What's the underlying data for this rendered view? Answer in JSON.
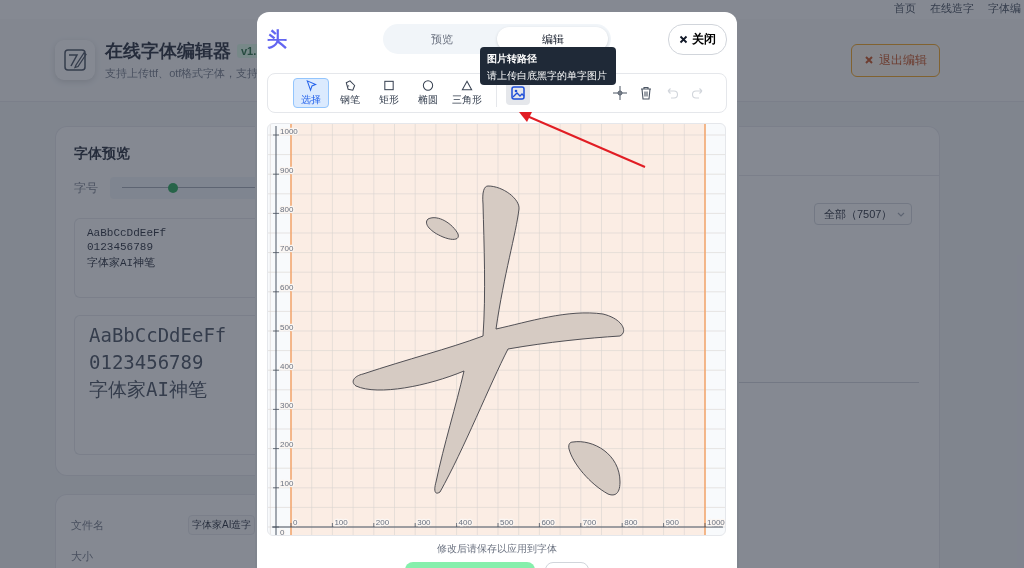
{
  "nav": [
    {
      "label": "首页"
    },
    {
      "label": "在线造字"
    },
    {
      "label": "字体编"
    }
  ],
  "header": {
    "title": "在线字体编辑器",
    "version": "v1.",
    "subtitle": "支持上传ttf、otf格式字体，支持",
    "exit_button": "退出编辑"
  },
  "preview_card": {
    "title": "字体预览",
    "size_label": "字号",
    "size_slider": {
      "level": 0.35
    },
    "sample_lines": [
      "AaBbCcDdEeFf",
      "0123456789",
      "字体家AI神笔"
    ],
    "rendered_lines": [
      "AaBbCcDdEeFf",
      "0123456789",
      "字体家AI神笔"
    ]
  },
  "info_card": {
    "rows": [
      {
        "label": "文件名",
        "value": "字体家AI造字"
      },
      {
        "label": "大小"
      }
    ]
  },
  "filter_select": {
    "value": "全部（7507）"
  },
  "editor": {
    "glyph": "头",
    "tabs": [
      {
        "label": "预览",
        "selected": false
      },
      {
        "label": "编辑",
        "selected": true
      }
    ],
    "close_button": "关闭",
    "tools": [
      {
        "kind": "pointer",
        "label": "选择",
        "selected": true
      },
      {
        "kind": "pen",
        "label": "钢笔",
        "selected": false
      },
      {
        "kind": "rect",
        "label": "矩形",
        "selected": false
      },
      {
        "kind": "ellipse",
        "label": "椭圆",
        "selected": false
      },
      {
        "kind": "triangle",
        "label": "三角形",
        "selected": false
      }
    ],
    "actions": [
      {
        "kind": "crosshair",
        "disabled": false
      },
      {
        "kind": "trash",
        "disabled": false
      },
      {
        "kind": "undo",
        "disabled": true
      },
      {
        "kind": "redo",
        "disabled": true
      }
    ],
    "tooltip": {
      "title": "图片转路径",
      "text": "请上传白底黑字的单字图片"
    },
    "x_ticks": [
      "0",
      "100",
      "200",
      "300",
      "400",
      "500",
      "600",
      "700",
      "800",
      "900",
      "1000"
    ],
    "y_ticks": [
      "1000",
      "900",
      "800",
      "700",
      "600",
      "500",
      "400",
      "300",
      "200",
      "100",
      "0"
    ],
    "hint": "修改后请保存以应用到字体",
    "buttons": [
      {
        "kind": "primary"
      },
      {
        "kind": "secondary"
      }
    ]
  }
}
